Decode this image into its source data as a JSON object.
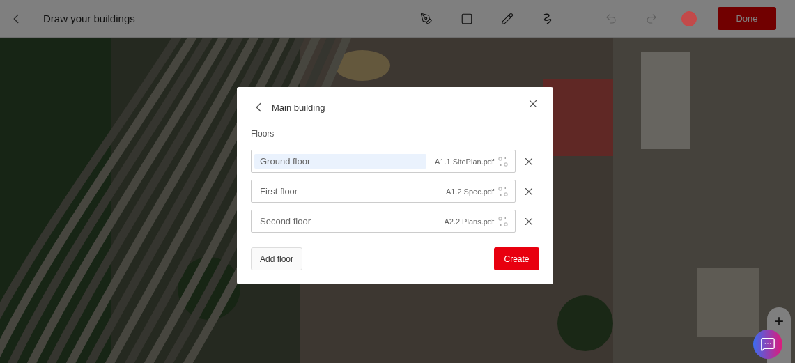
{
  "toolbar": {
    "title": "Draw your buildings",
    "tools": [
      {
        "kind": "pen"
      },
      {
        "kind": "square"
      },
      {
        "kind": "pencil"
      },
      {
        "kind": "squiggle"
      }
    ],
    "undo": {
      "disabled": true
    },
    "redo": {
      "disabled": true
    },
    "color": "#c24a4a",
    "done": "Done"
  },
  "map": {
    "kind": "picture",
    "zoom_in": "+"
  },
  "dialog": {
    "title": "Main building",
    "section": "Floors",
    "floors": [
      {
        "name": "Ground floor",
        "file": "A1.1 SitePlan.pdf",
        "selected": true
      },
      {
        "name": "First floor",
        "file": "A1.2 Spec.pdf",
        "selected": false
      },
      {
        "name": "Second floor",
        "file": "A2.2 Plans.pdf",
        "selected": false
      }
    ],
    "add": "Add floor",
    "create": "Create"
  }
}
